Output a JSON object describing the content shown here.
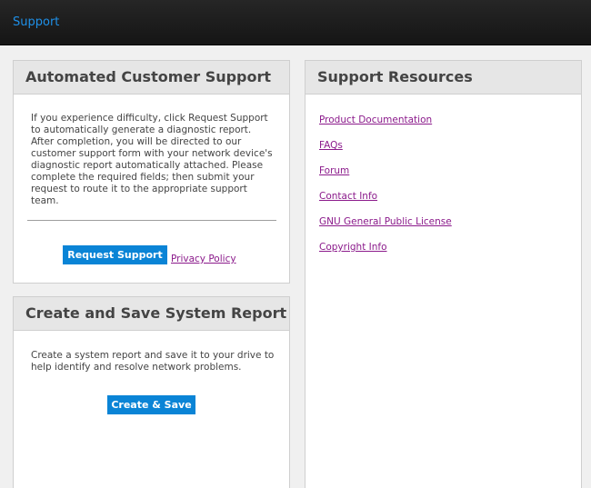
{
  "header": {
    "title": "Support"
  },
  "automated_support": {
    "title": "Automated Customer Support",
    "description": "If you experience difficulty, click Request Support to automatically generate a diagnostic report. After completion, you will be directed to our customer support form with your network device's diagnostic report automatically attached. Please complete the required fields; then submit your request to route it to the appropriate support team.",
    "request_button": "Request Support",
    "privacy_link": "Privacy Policy"
  },
  "system_report": {
    "title": "Create and Save System Report",
    "description": "Create a system report and save it to your drive to help identify and resolve network problems.",
    "create_button": "Create & Save"
  },
  "resources": {
    "title": "Support Resources",
    "links": [
      "Product Documentation",
      "FAQs",
      "Forum",
      "Contact Info",
      "GNU General Public License",
      "Copyright Info"
    ]
  },
  "colors": {
    "topbar": "#1a1a1a",
    "header_link": "#1e90e8",
    "button": "#0a84d6",
    "link": "#8b1a8b"
  }
}
